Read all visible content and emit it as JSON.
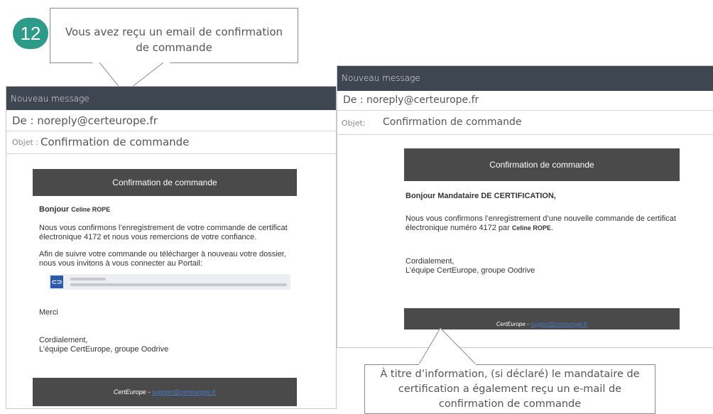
{
  "step": {
    "number": "12"
  },
  "callout_top": {
    "text": "Vous avez reçu un email de confirmation de commande"
  },
  "callout_bottom": {
    "text": "À titre d’information, (si déclaré) le mandataire de certification a également reçu un e-mail de confirmation de commande"
  },
  "email_left": {
    "window_title": "Nouveau message",
    "from": "De : noreply@certeurope.fr",
    "subject_label": "Objet :",
    "subject": "Confirmation de commande",
    "banner_title": "Confirmation de commande",
    "greeting_prefix": "Bonjour",
    "greeting_name": "Celine ROPE",
    "paragraph1": "Nous vous confirmons l’enregistrement de votre commande de certificat électronique 4172 et nous vous remercions de votre confiance.",
    "paragraph2": "Afin de suivre votre commande ou télécharger à nouveau votre dossier, nous vous invitons à vous connecter au Portail:",
    "portal_icon": "link-icon",
    "thanks": "Merci",
    "closing": "Cordialement,",
    "signature": "L’équipe CertEurope, groupe Oodrive",
    "footer_prefix": "CertEurope -",
    "footer_link": "support@certeurope.fr"
  },
  "email_right": {
    "window_title": "Nouveau message",
    "from": "De : noreply@certeurope.fr",
    "subject_label": "Objet:",
    "subject": "Confirmation de commande",
    "banner_title": "Confirmation de commande",
    "greeting": "Bonjour Mandataire DE CERTIFICATION,",
    "paragraph1": "Nous vous confirmons l’enregistrement d’une nouvelle commande de certificat électronique numéro 4172 par",
    "paragraph1_name": "Celine ROPE",
    "closing": "Cordialement,",
    "signature": "L’équipe CertEurope, groupe Oodrive",
    "footer_prefix": "CertEurope -",
    "footer_link": "support@certeurope.fr"
  },
  "colors": {
    "badge": "#2e9a8a",
    "titlebar": "#3d4651",
    "banner": "#4a4a4a"
  }
}
